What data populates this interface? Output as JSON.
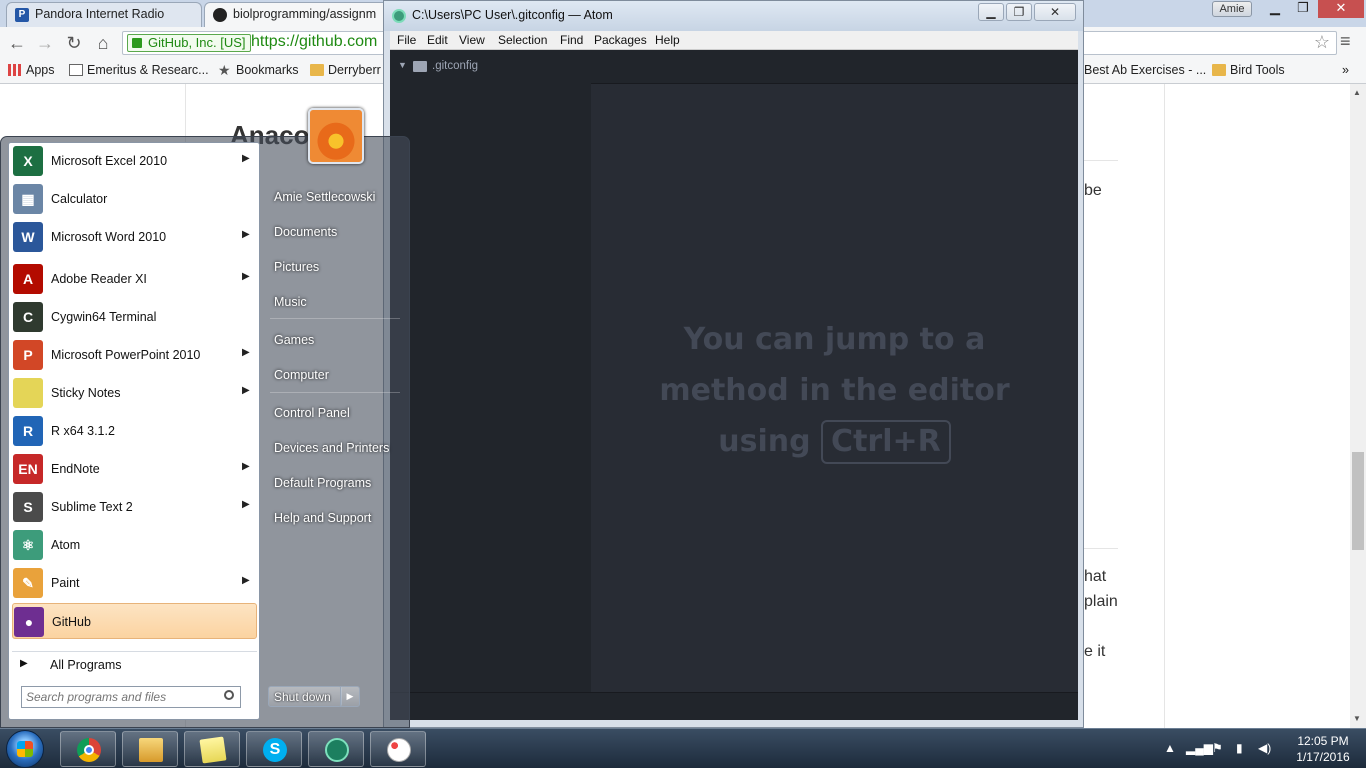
{
  "browser": {
    "tabs": [
      {
        "title": "Pandora Internet Radio"
      },
      {
        "title": "biolprogramming/assignm"
      }
    ],
    "profile": "Amie",
    "ev_badge": "GitHub, Inc. [US]",
    "url": "https://github.com",
    "bookmarks": [
      {
        "label": "Apps",
        "icon": "apps-icon"
      },
      {
        "label": "Emeritus & Researc...",
        "icon": "page-icon"
      },
      {
        "label": "Bookmarks",
        "icon": "star-icon"
      },
      {
        "label": "Derryberr",
        "icon": "folder-icon"
      },
      {
        "label": "Best Ab Exercises - ...",
        "icon": "folder-icon"
      },
      {
        "label": "Bird Tools",
        "icon": "folder-icon"
      }
    ],
    "page_fragments": {
      "heading": "Anaco",
      "right1": "be",
      "right2": "hat",
      "right3": "plain",
      "right4": "e it"
    }
  },
  "atom": {
    "title": "C:\\Users\\PC User\\.gitconfig — Atom",
    "menu": [
      "File",
      "Edit",
      "View",
      "Selection",
      "Find",
      "Packages",
      "Help"
    ],
    "tree_root": ".gitconfig",
    "hint_text": "You can jump to a method in the editor using",
    "hint_key": "Ctrl+R"
  },
  "start_menu": {
    "programs": [
      {
        "label": "Microsoft Excel 2010",
        "icon": "excel-icon",
        "has_submenu": true,
        "color": "#1d6f42",
        "glyph": "X"
      },
      {
        "label": "Calculator",
        "icon": "calculator-icon",
        "has_submenu": false,
        "color": "#6b86a6",
        "glyph": "▦"
      },
      {
        "label": "Microsoft Word 2010",
        "icon": "word-icon",
        "has_submenu": true,
        "color": "#2b579a",
        "glyph": "W"
      },
      {
        "label": "Adobe Reader XI",
        "icon": "adobe-reader-icon",
        "has_submenu": true,
        "color": "#b30b00",
        "glyph": "A"
      },
      {
        "label": "Cygwin64 Terminal",
        "icon": "cygwin-icon",
        "has_submenu": false,
        "color": "#2f3a2f",
        "glyph": "C"
      },
      {
        "label": "Microsoft PowerPoint 2010",
        "icon": "powerpoint-icon",
        "has_submenu": true,
        "color": "#d24726",
        "glyph": "P"
      },
      {
        "label": "Sticky Notes",
        "icon": "sticky-notes-icon",
        "has_submenu": true,
        "color": "#e4d557",
        "glyph": ""
      },
      {
        "label": "R x64 3.1.2",
        "icon": "r-icon",
        "has_submenu": false,
        "color": "#2165b6",
        "glyph": "R"
      },
      {
        "label": "EndNote",
        "icon": "endnote-icon",
        "has_submenu": true,
        "color": "#c62828",
        "glyph": "EN"
      },
      {
        "label": "Sublime Text 2",
        "icon": "sublime-icon",
        "has_submenu": true,
        "color": "#4b4b4b",
        "glyph": "S"
      },
      {
        "label": "Atom",
        "icon": "atom-icon",
        "has_submenu": false,
        "color": "#3d9c7b",
        "glyph": "⚛"
      },
      {
        "label": "Paint",
        "icon": "paint-icon",
        "has_submenu": true,
        "color": "#e9a23b",
        "glyph": "✎"
      },
      {
        "label": "GitHub",
        "icon": "github-icon",
        "has_submenu": false,
        "color": "#6e2e91",
        "glyph": "●",
        "selected": true
      }
    ],
    "all_programs": "All Programs",
    "search_placeholder": "Search programs and files",
    "right_items": [
      "Amie Settlecowski",
      "Documents",
      "Pictures",
      "Music",
      "Games",
      "Computer",
      "Control Panel",
      "Devices and Printers",
      "Default Programs",
      "Help and Support"
    ],
    "shutdown": "Shut down"
  },
  "taskbar": {
    "apps": [
      "Google Chrome",
      "Windows Explorer",
      "Sticky Notes",
      "Skype",
      "Atom",
      "Paint"
    ],
    "time": "12:05 PM",
    "date": "1/17/2016"
  }
}
